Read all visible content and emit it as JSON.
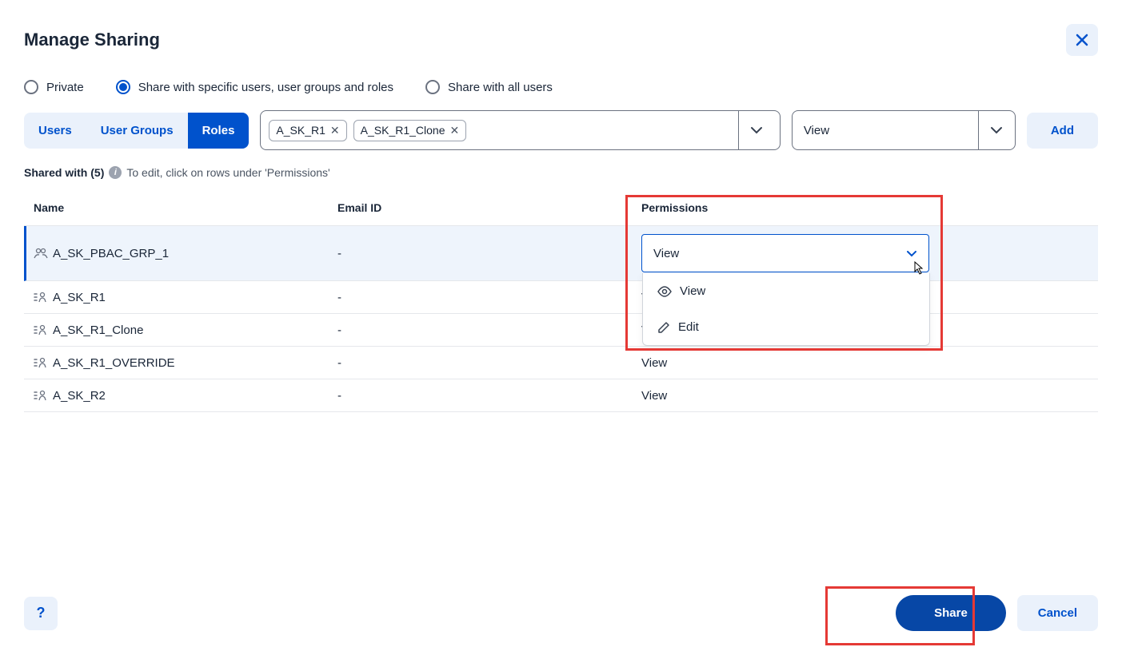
{
  "title": "Manage Sharing",
  "radio_options": {
    "private": "Private",
    "specific": "Share with specific users, user groups and roles",
    "all": "Share with all users"
  },
  "radio_selected": "specific",
  "tabs": {
    "users": "Users",
    "user_groups": "User Groups",
    "roles": "Roles"
  },
  "tab_active": "roles",
  "chips": [
    "A_SK_R1",
    "A_SK_R1_Clone"
  ],
  "permission_select_value": "View",
  "add_label": "Add",
  "shared_with_label": "Shared with",
  "shared_with_count": "(5)",
  "shared_with_hint": "To edit, click on rows under 'Permissions'",
  "table": {
    "headers": {
      "name": "Name",
      "email": "Email ID",
      "permissions": "Permissions"
    },
    "rows": [
      {
        "icon": "group",
        "name": "A_SK_PBAC_GRP_1",
        "email": "-",
        "permission": "View",
        "editing": true
      },
      {
        "icon": "role",
        "name": "A_SK_R1",
        "email": "-",
        "permission": "View",
        "editing": false
      },
      {
        "icon": "role",
        "name": "A_SK_R1_Clone",
        "email": "-",
        "permission": "View",
        "editing": false
      },
      {
        "icon": "role",
        "name": "A_SK_R1_OVERRIDE",
        "email": "-",
        "permission": "View",
        "editing": false
      },
      {
        "icon": "role",
        "name": "A_SK_R2",
        "email": "-",
        "permission": "View",
        "editing": false
      }
    ]
  },
  "dropdown_options": {
    "view": "View",
    "edit": "Edit"
  },
  "footer": {
    "share": "Share",
    "cancel": "Cancel",
    "help": "?"
  }
}
